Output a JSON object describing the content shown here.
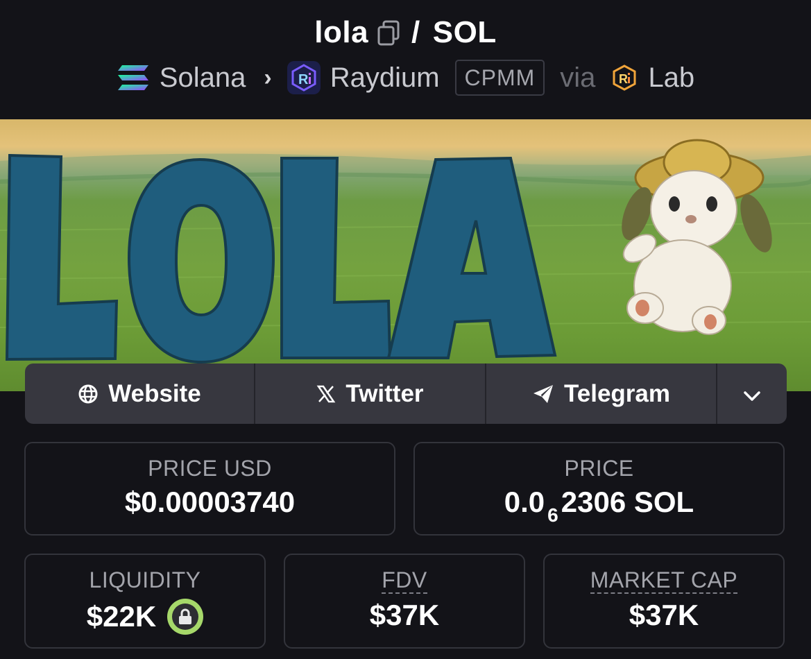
{
  "header": {
    "token": "lola",
    "separator": "/",
    "quote": "SOL",
    "chain": "Solana",
    "dex": "Raydium",
    "pool_type": "CPMM",
    "via_label": "via",
    "launchpad": "Lab"
  },
  "banner": {
    "text": "LOLA"
  },
  "social": {
    "website_label": "Website",
    "twitter_label": "Twitter",
    "telegram_label": "Telegram"
  },
  "stats": {
    "price_usd_label": "PRICE USD",
    "price_usd_value": "$0.00003740",
    "price_label": "PRICE",
    "price_prefix": "0.0",
    "price_zero_count": "6",
    "price_suffix": "2306 SOL",
    "liquidity_label": "LIQUIDITY",
    "liquidity_value": "$22K",
    "fdv_label": "FDV",
    "fdv_value": "$37K",
    "market_cap_label": "MARKET CAP",
    "market_cap_value": "$37K"
  },
  "colors": {
    "background": "#131318",
    "card_border": "#33343b",
    "social_bg": "#37373f",
    "lock_green": "#a6d86a",
    "raydium_purple": "#6b4cf5"
  }
}
